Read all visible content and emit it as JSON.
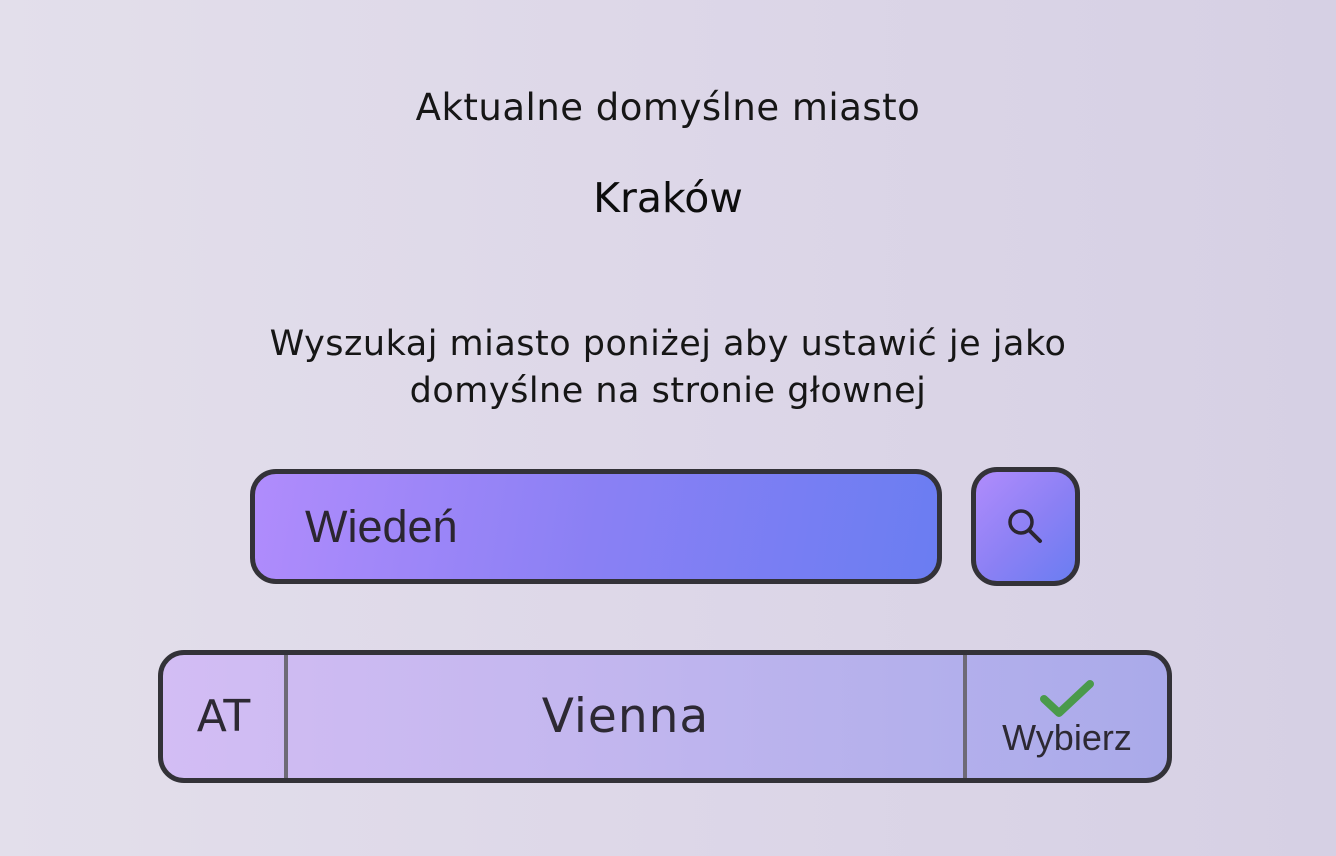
{
  "current": {
    "label": "Aktualne domyślne miasto",
    "city": "Kraków"
  },
  "instructions": "Wyszukaj miasto poniżej aby ustawić je jako domyślne na stronie głownej",
  "search": {
    "value": "Wiedeń",
    "button_icon": "search-icon"
  },
  "results": [
    {
      "country_code": "AT",
      "city": "Vienna",
      "select_label": "Wybierz",
      "select_icon": "checkmark-icon"
    }
  ],
  "colors": {
    "check": "#4a9a4a",
    "border": "#333238",
    "gradient_start": "#b08cfc",
    "gradient_end": "#6a7df2"
  }
}
